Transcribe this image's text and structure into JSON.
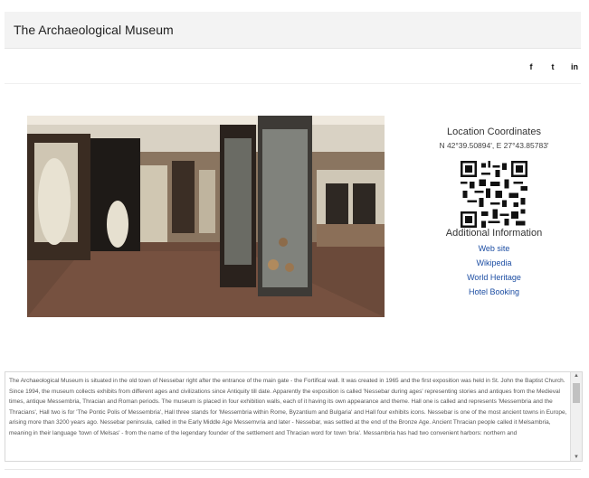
{
  "header": {
    "title": "The Archaeological Museum"
  },
  "social": [
    {
      "icon": "facebook-icon",
      "glyph": "f"
    },
    {
      "icon": "twitter-icon",
      "glyph": "t"
    },
    {
      "icon": "linkedin-icon",
      "glyph": "in"
    }
  ],
  "sidebar": {
    "location_title": "Location Coordinates",
    "coordinates": "N 42°39.50894', E 27°43.85783'",
    "additional_title": "Additional Information",
    "links": [
      "Web site",
      "Wikipedia",
      "World Heritage"
    ],
    "hotel_booking": "Hotel Booking"
  },
  "description": "The Archaeological Museum is situated in the old town of Nessebar right after the entrance of the main gate - the Fortifical wall. It was created in 1965 and the first exposition was held in St. John the Baptist Church. Since 1994, the museum collects exhibits from different ages and civilizations since Antiquity till date. Apparently the exposition is called 'Nessebar during ages' representing stories and antiques from the Medieval times, antique Messembria, Thracian and Roman periods. The museum is placed in four exhibition walls, each of it having its own appearance and theme. Hall one is called and represents 'Messembria and the Thracians', Hall two is for 'The Pontic Polis of Messembria', Hall three stands for 'Messembria within Rome, Byzantium and Bulgaria' and Hall four exhibits icons. Nessebar is one of the most ancient towns in Europe, arising more than 3200 years ago. Nessebar peninsula, called in the Early Middle Age Messemvria and later - Nessebar, was settled at the end of the Bronze Age. Ancient Thracian people called it Melsambria, meaning in their language 'town of Melsas' - from the name of the legendary founder of the settlement and Thracian word for town 'bria'. Messambria has had two convenient harbors: northern and",
  "colors": {
    "link": "#1d4ea3",
    "header_bg": "#f3f3f3"
  }
}
